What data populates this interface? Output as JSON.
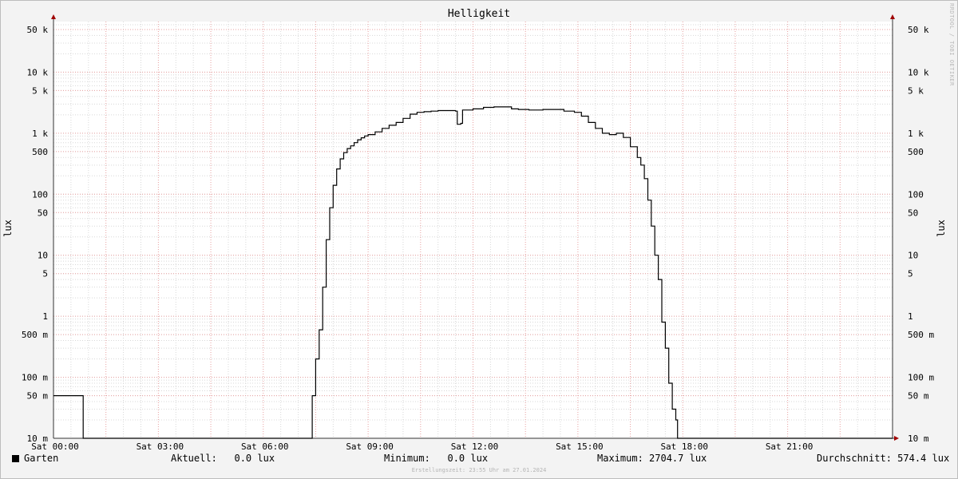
{
  "chart_data": {
    "type": "line",
    "title": "Helligkeit",
    "ylabel": "lux",
    "yscale": "log",
    "ylim": [
      0.01,
      80000
    ],
    "xlim": [
      0,
      24
    ],
    "grid": true,
    "y_ticks": [
      {
        "v": 50000,
        "label": "50 k"
      },
      {
        "v": 10000,
        "label": "10 k"
      },
      {
        "v": 5000,
        "label": "5 k"
      },
      {
        "v": 1000,
        "label": "1 k"
      },
      {
        "v": 500,
        "label": "500"
      },
      {
        "v": 100,
        "label": "100"
      },
      {
        "v": 50,
        "label": "50"
      },
      {
        "v": 10,
        "label": "10"
      },
      {
        "v": 5,
        "label": "5"
      },
      {
        "v": 1,
        "label": "1"
      },
      {
        "v": 0.5,
        "label": "500 m"
      },
      {
        "v": 0.1,
        "label": "100 m"
      },
      {
        "v": 0.05,
        "label": "50 m"
      },
      {
        "v": 0.01,
        "label": "10 m"
      }
    ],
    "x_ticks": [
      {
        "v": 0,
        "label": "Sat 00:00"
      },
      {
        "v": 3,
        "label": "Sat 03:00"
      },
      {
        "v": 6,
        "label": "Sat 06:00"
      },
      {
        "v": 9,
        "label": "Sat 09:00"
      },
      {
        "v": 12,
        "label": "Sat 12:00"
      },
      {
        "v": 15,
        "label": "Sat 15:00"
      },
      {
        "v": 18,
        "label": "Sat 18:00"
      },
      {
        "v": 21,
        "label": "Sat 21:00"
      }
    ],
    "series": [
      {
        "name": "Garten",
        "color": "#000000",
        "x": [
          0,
          0.8,
          0.85,
          7.35,
          7.4,
          7.5,
          7.6,
          7.7,
          7.8,
          7.9,
          8.0,
          8.1,
          8.2,
          8.3,
          8.4,
          8.5,
          8.6,
          8.7,
          8.8,
          8.9,
          9.0,
          9.2,
          9.4,
          9.6,
          9.8,
          10.0,
          10.2,
          10.4,
          10.6,
          10.8,
          11.0,
          11.2,
          11.5,
          11.55,
          11.65,
          11.7,
          12.0,
          12.3,
          12.6,
          12.9,
          13.1,
          13.3,
          13.6,
          14.0,
          14.3,
          14.6,
          14.9,
          15.1,
          15.3,
          15.5,
          15.7,
          15.9,
          16.1,
          16.3,
          16.5,
          16.7,
          16.8,
          16.9,
          17.0,
          17.1,
          17.2,
          17.3,
          17.4,
          17.5,
          17.6,
          17.7,
          17.8,
          17.85,
          17.9,
          17.95,
          18.0,
          24.0
        ],
        "values": [
          0.05,
          0.05,
          0.01,
          0.01,
          0.05,
          0.2,
          0.6,
          3,
          18,
          60,
          140,
          260,
          380,
          480,
          560,
          620,
          700,
          780,
          840,
          900,
          950,
          1050,
          1200,
          1350,
          1500,
          1750,
          2050,
          2200,
          2250,
          2300,
          2350,
          2350,
          2300,
          1400,
          1450,
          2400,
          2500,
          2650,
          2700,
          2700,
          2500,
          2450,
          2400,
          2450,
          2450,
          2300,
          2200,
          1900,
          1500,
          1200,
          1000,
          950,
          1000,
          850,
          600,
          400,
          300,
          180,
          80,
          30,
          10,
          4,
          0.8,
          0.3,
          0.08,
          0.03,
          0.02,
          0.01,
          0.01,
          0.01,
          0.01,
          0.01
        ]
      }
    ]
  },
  "legend": {
    "series_name": "Garten",
    "aktuell": "Aktuell:   0.0 lux",
    "minimum": "Minimum:   0.0 lux",
    "maximum": "Maximum: 2704.7 lux",
    "durchschnitt": "Durchschnitt: 574.4 lux"
  },
  "footer": "Erstellungszeit: 23:55 Uhr am 27.01.2024",
  "watermark": "RRDTOOL / TOBI OETIKER"
}
